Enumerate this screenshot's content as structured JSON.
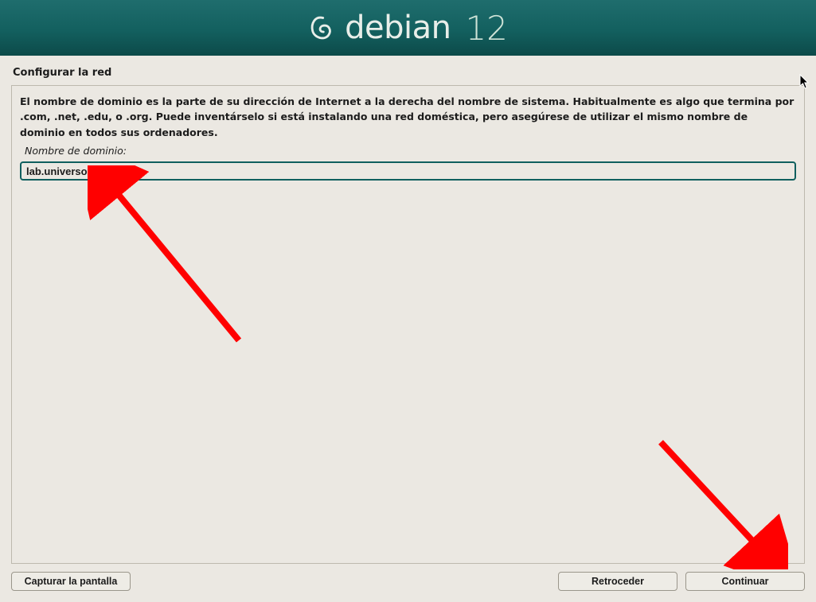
{
  "banner": {
    "brand": "debian",
    "version": "12"
  },
  "page": {
    "title": "Configurar la red"
  },
  "main": {
    "description": "El nombre de dominio es la parte de su dirección de Internet a la derecha del nombre de sistema. Habitualmente es algo que termina por .com, .net, .edu, o .org. Puede inventárselo si está instalando una red doméstica, pero asegúrese de utilizar el mismo nombre de dominio en todos sus ordenadores.",
    "domain_label": "Nombre de dominio:",
    "domain_value": "lab.universodigital.org"
  },
  "footer": {
    "screenshot": "Capturar la pantalla",
    "back": "Retroceder",
    "continue": "Continuar"
  }
}
